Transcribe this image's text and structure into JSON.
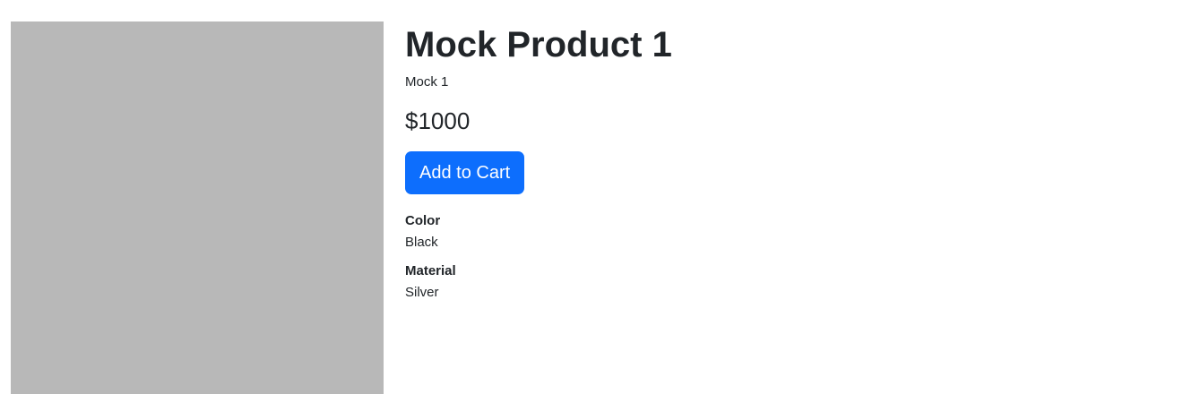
{
  "product": {
    "title": "Mock Product 1",
    "subtitle": "Mock 1",
    "price": "$1000",
    "add_to_cart_label": "Add to Cart",
    "image_placeholder_color": "#b8b8b8",
    "attributes": [
      {
        "label": "Color",
        "value": "Black"
      },
      {
        "label": "Material",
        "value": "Silver"
      }
    ]
  },
  "colors": {
    "accent": "#0d6efd",
    "text": "#212529"
  }
}
